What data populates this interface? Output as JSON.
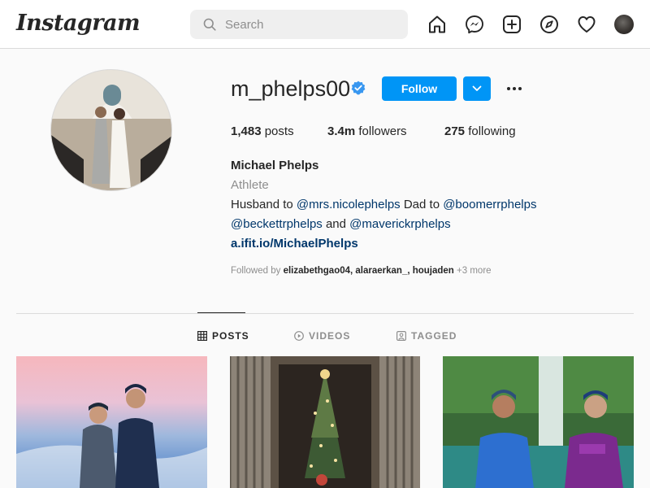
{
  "topbar": {
    "logo": "Instagram",
    "search_placeholder": "Search",
    "icons": [
      "home-icon",
      "messenger-icon",
      "new-post-icon",
      "explore-icon",
      "activity-heart-icon",
      "profile-avatar"
    ]
  },
  "profile": {
    "username": "m_phelps00",
    "verified": true,
    "follow_label": "Follow",
    "posts_count": "1,483",
    "posts_label": "posts",
    "followers_count": "3.4m",
    "followers_label": "followers",
    "following_count": "275",
    "following_label": "following",
    "full_name": "Michael Phelps",
    "category": "Athlete",
    "bio": {
      "line1_text1": "Husband to ",
      "mention1": "@mrs.nicolephelps",
      "line1_text2": " Dad to ",
      "mention2": "@boomerrphelps",
      "mention3": "@beckettrphelps",
      "line2_text": " and ",
      "mention4": "@maverickrphelps"
    },
    "link": "a.ifit.io/MichaelPhelps",
    "followed_by_prefix": "Followed by ",
    "followed_by_users": "elizabethgao04, alaraerkan_, houjaden",
    "followed_by_more": " +3 more"
  },
  "tabs": [
    {
      "label": "POSTS",
      "active": true
    },
    {
      "label": "VIDEOS",
      "active": false
    },
    {
      "label": "TAGGED",
      "active": false
    }
  ],
  "colors": {
    "accent": "#0095f6",
    "mention": "#00376b",
    "muted": "#8e8e8e",
    "border": "#dbdbdb"
  }
}
